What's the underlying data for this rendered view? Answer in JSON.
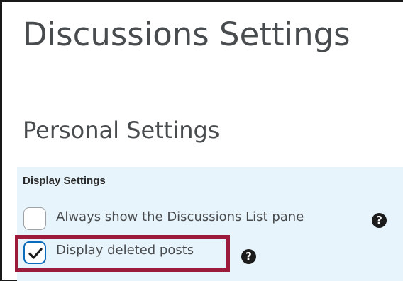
{
  "page": {
    "title": "Discussions Settings"
  },
  "personal_settings": {
    "heading": "Personal Settings",
    "display_settings": {
      "group_label": "Display Settings",
      "options": [
        {
          "label": "Always show the Discussions List pane",
          "checked": false,
          "help_icon": "question-circle-icon"
        },
        {
          "label": "Display deleted posts",
          "checked": true,
          "help_icon": "question-circle-icon",
          "highlighted": true
        }
      ]
    }
  },
  "help_glyph": "?",
  "colors": {
    "panel_background": "#e8f4fb",
    "checkbox_checked_border": "#0a6bbd",
    "highlight_border": "#9c1a3a",
    "heading_text": "#494c4e"
  }
}
